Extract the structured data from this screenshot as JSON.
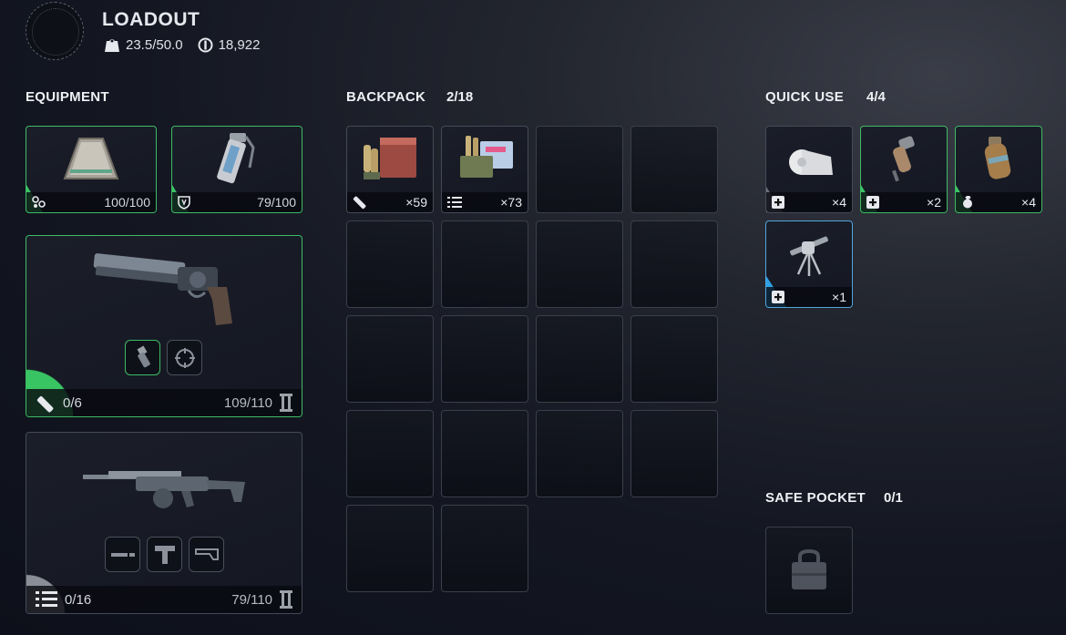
{
  "header": {
    "title": "LOADOUT",
    "weight": "23.5/50.0",
    "currency": "18,922",
    "weight_icon": "weight-bag-icon",
    "currency_icon": "coin-icon"
  },
  "equipment": {
    "title": "EQUIPMENT",
    "augment": {
      "icon": "augment-icon",
      "value": "100/100"
    },
    "shield": {
      "icon": "shield-icon",
      "value": "79/100"
    },
    "weapon1": {
      "ammo": "0/6",
      "durability": "109/110",
      "tier_icon": "tier-2-icon"
    },
    "weapon2": {
      "ammo": "0/16",
      "durability": "79/110",
      "tier_icon": "tier-2-icon"
    }
  },
  "backpack": {
    "title": "BACKPACK",
    "count": "2/18",
    "items": [
      {
        "icon": "heavy-ammo-icon",
        "qty": "×59"
      },
      {
        "icon": "light-ammo-icon",
        "qty": "×73"
      }
    ]
  },
  "quick_use": {
    "title": "QUICK USE",
    "count": "4/4",
    "items": [
      {
        "icon": "bandage-icon",
        "badge": "medical-icon",
        "qty": "×4"
      },
      {
        "icon": "injector-icon",
        "badge": "medical-icon",
        "qty": "×2"
      },
      {
        "icon": "grenade-icon",
        "badge": "grenade-badge-icon",
        "qty": "×4"
      },
      {
        "icon": "turret-icon",
        "badge": "medical-icon",
        "qty": "×1"
      }
    ]
  },
  "safe_pocket": {
    "title": "SAFE POCKET",
    "count": "0/1",
    "icon": "lock-icon"
  },
  "colors": {
    "rarity_green": "#39c463",
    "rarity_blue": "#2fa1e6",
    "rarity_gray": "#8a8e97"
  }
}
